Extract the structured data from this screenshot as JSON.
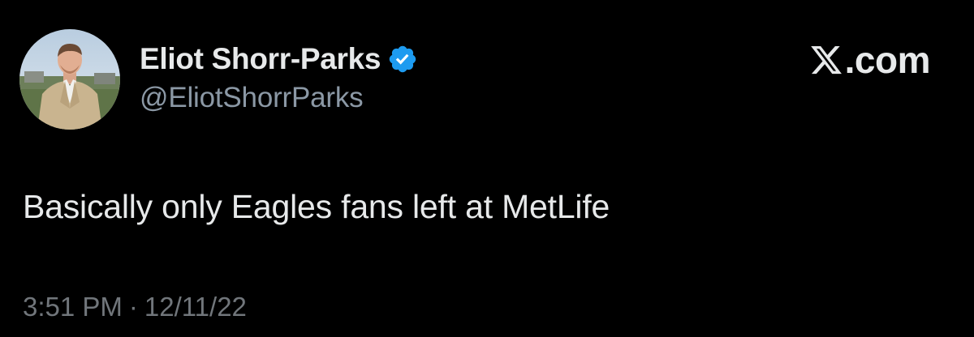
{
  "author": {
    "display_name": "Eliot Shorr-Parks",
    "handle": "@EliotShorrParks",
    "verified": true,
    "avatar_icon": "profile-photo"
  },
  "brand": {
    "text": ".com",
    "icon": "x-logo-icon"
  },
  "tweet": {
    "text": "Basically only Eagles fans left at MetLife",
    "time": "3:51 PM",
    "separator": "·",
    "date": "12/11/22"
  },
  "colors": {
    "background": "#000000",
    "primary_text": "#e7e9ea",
    "secondary_text": "#8b98a5",
    "meta_text": "#71767b",
    "verified_badge": "#1d9bf0"
  }
}
